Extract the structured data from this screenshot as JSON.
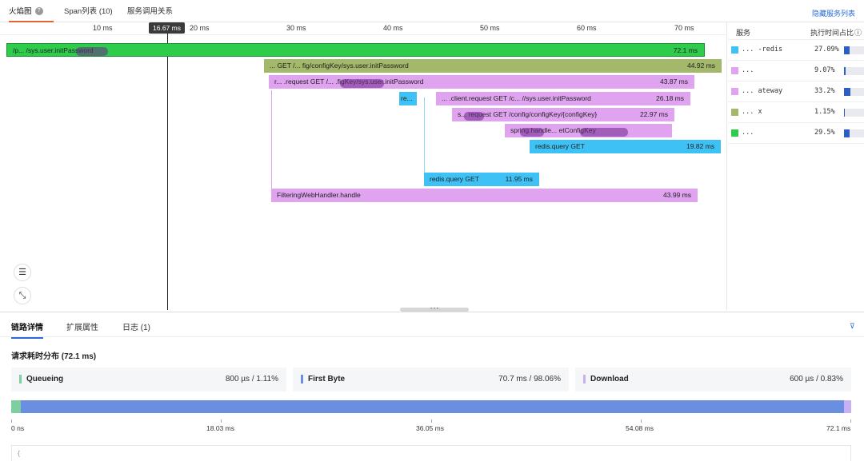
{
  "tabs": [
    {
      "label": "火焰图"
    },
    {
      "label": "Span列表 (10)"
    },
    {
      "label": "服务调用关系"
    }
  ],
  "hide_services_label": "隐藏服务列表",
  "flame": {
    "cursor_label": "16.67 ms",
    "ticks": [
      "10 ms",
      "20 ms",
      "30 ms",
      "40 ms",
      "50 ms",
      "60 ms",
      "70 ms"
    ],
    "spans": [
      {
        "label": "/p... /sys.user.initPassword",
        "duration": "72.1 ms",
        "color": "#2ecc4b"
      },
      {
        "label": "... GET /... fig/configKey/sys.user.initPassword",
        "duration": "44.92 ms",
        "color": "#a3b86b"
      },
      {
        "label": "r... .request GET /... .figKey/sys.user.initPassword",
        "duration": "43.87 ms",
        "color": "#e0a3f0"
      },
      {
        "label": "re...",
        "duration": "",
        "color": "#3ec1f5"
      },
      {
        "label": "... .client.request GET /c... //sys.user.initPassword",
        "duration": "26.18 ms",
        "color": "#e0a3f0"
      },
      {
        "label": "s... request GET /config/configKey/{configKey}",
        "duration": "22.97 ms",
        "color": "#e0a3f0"
      },
      {
        "label": "spring.handle... etConfigKey",
        "duration": "",
        "color": "#e0a3f0"
      },
      {
        "label": "redis.query GET",
        "duration": "19.82 ms",
        "color": "#3ec1f5"
      },
      {
        "label": "redis.query GET",
        "duration": "11.95 ms",
        "color": "#3ec1f5"
      },
      {
        "label": "FilteringWebHandler.handle",
        "duration": "43.99 ms",
        "color": "#e0a3f0"
      }
    ]
  },
  "services": {
    "header_service": "服务",
    "header_ratio": "执行时间占比",
    "rows": [
      {
        "name": "... -redis",
        "pct": "27.09%",
        "ratio": 0.2709,
        "color": "#3ec1f5"
      },
      {
        "name": "... ",
        "pct": "9.07%",
        "ratio": 0.0907,
        "color": "#e0a3f0"
      },
      {
        "name": "... ateway",
        "pct": "33.2%",
        "ratio": 0.332,
        "color": "#e0a3f0"
      },
      {
        "name": "... x",
        "pct": "1.15%",
        "ratio": 0.0115,
        "color": "#a3b86b"
      },
      {
        "name": "... ",
        "pct": "29.5%",
        "ratio": 0.295,
        "color": "#2ecc4b"
      }
    ]
  },
  "bottom_tabs": [
    {
      "label": "链路详情"
    },
    {
      "label": "扩展属性"
    },
    {
      "label": "日志 (1)"
    }
  ],
  "timing": {
    "title": "请求耗时分布 (72.1 ms)",
    "phases": [
      {
        "name": "Queueing",
        "value": "800 µs  /  1.11%",
        "fraction": 0.0111,
        "color": "#7dcf9f"
      },
      {
        "name": "First Byte",
        "value": "70.7 ms  /  98.06%",
        "fraction": 0.9806,
        "color": "#6b8fe0"
      },
      {
        "name": "Download",
        "value": "600 µs  /  0.83%",
        "fraction": 0.0083,
        "color": "#c9b0f0"
      }
    ],
    "axis": [
      "0 ns",
      "18.03 ms",
      "36.05 ms",
      "54.08 ms",
      "72.1 ms"
    ]
  },
  "code_preview": "{"
}
